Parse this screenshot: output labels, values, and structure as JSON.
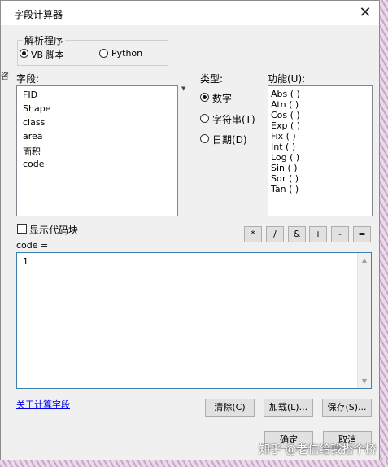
{
  "window": {
    "title": "字段计算器",
    "close_glyph": "✕"
  },
  "parser": {
    "group_label": "解析程序",
    "options": [
      {
        "label": "VB 脚本",
        "checked": true
      },
      {
        "label": "Python",
        "checked": false
      }
    ]
  },
  "fields": {
    "label": "字段:",
    "items": [
      "FID",
      "Shape",
      "class",
      "area",
      "面积",
      "code"
    ]
  },
  "type": {
    "label": "类型:",
    "options": [
      {
        "label": "数字",
        "checked": true
      },
      {
        "label": "字符串(T)",
        "checked": false
      },
      {
        "label": "日期(D)",
        "checked": false
      }
    ]
  },
  "functions": {
    "label": "功能(U):",
    "items": [
      "Abs ( )",
      "Atn ( )",
      "Cos ( )",
      "Exp ( )",
      "Fix ( )",
      "Int ( )",
      "Log ( )",
      "Sin ( )",
      "Sqr ( )",
      "Tan ( )"
    ]
  },
  "codeblock": {
    "label": "显示代码块",
    "checked": false
  },
  "operators": [
    "*",
    "/",
    "&",
    "+",
    "-",
    "="
  ],
  "expression": {
    "label": "code =",
    "value": "1"
  },
  "footer": {
    "help_link": "关于计算字段",
    "clear_label": "清除(C)",
    "load_label": "加载(L)...",
    "save_label": "保存(S)...",
    "ok_label": "确定",
    "cancel_label": "取消"
  },
  "background": {
    "left_char": "咨",
    "watermark": "知乎 @老信给我搭个桥"
  }
}
